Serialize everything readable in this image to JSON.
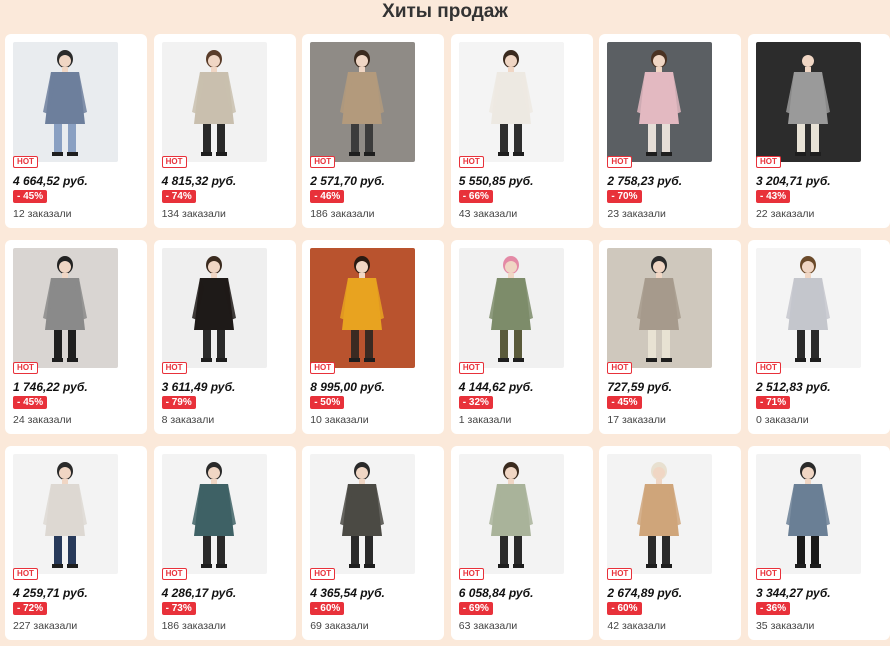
{
  "section_title": "Хиты продаж",
  "colors": {
    "background": "#fbe9da",
    "accent_red": "#e8313a"
  },
  "products": [
    {
      "badge": "HOT",
      "price": "4 664,52 руб.",
      "discount": "- 45%",
      "orders": "12 заказали",
      "image": "woman-blue-jacket-photo"
    },
    {
      "badge": "HOT",
      "price": "4 815,32 руб.",
      "discount": "- 74%",
      "orders": "134 заказали",
      "image": "woman-beige-puffer-coat-photo"
    },
    {
      "badge": "HOT",
      "price": "2 571,70 руб.",
      "discount": "- 46%",
      "orders": "186 заказали",
      "image": "woman-trench-coat-photo"
    },
    {
      "badge": "HOT",
      "price": "5 550,85 руб.",
      "discount": "- 66%",
      "orders": "43 заказали",
      "image": "woman-white-fur-coat-photo"
    },
    {
      "badge": "HOT",
      "price": "2 758,23 руб.",
      "discount": "- 70%",
      "orders": "23 заказали",
      "image": "woman-pink-jacket-photo"
    },
    {
      "badge": "HOT",
      "price": "3 204,71 руб.",
      "discount": "- 43%",
      "orders": "22 заказали",
      "image": "patterned-jacket-photo"
    },
    {
      "badge": "HOT",
      "price": "1 746,22 руб.",
      "discount": "- 45%",
      "orders": "24 заказали",
      "image": "woman-hat-grey-coat-photo"
    },
    {
      "badge": "HOT",
      "price": "3 611,49 руб.",
      "discount": "- 79%",
      "orders": "8 заказали",
      "image": "woman-black-leather-jacket-photo"
    },
    {
      "badge": "HOT",
      "price": "8 995,00 руб.",
      "discount": "- 50%",
      "orders": "10 заказали",
      "image": "woman-yellow-puffer-photo"
    },
    {
      "badge": "HOT",
      "price": "4 144,62 руб.",
      "discount": "- 32%",
      "orders": "1 заказали",
      "image": "woman-snakeskin-jacket-photo"
    },
    {
      "badge": "HOT",
      "price": "727,59 руб.",
      "discount": "- 45%",
      "orders": "17 заказали",
      "image": "woman-plaid-cardigan-photo"
    },
    {
      "badge": "HOT",
      "price": "2 512,83 руб.",
      "discount": "- 71%",
      "orders": "0 заказали",
      "image": "woman-silver-puffer-photo"
    },
    {
      "badge": "HOT",
      "price": "4 259,71 руб.",
      "discount": "- 72%",
      "orders": "227 заказали",
      "image": "woman-white-long-puffer-photo"
    },
    {
      "badge": "HOT",
      "price": "4 286,17 руб.",
      "discount": "- 73%",
      "orders": "186 заказали",
      "image": "woman-teal-long-coat-photo"
    },
    {
      "badge": "HOT",
      "price": "4 365,54 руб.",
      "discount": "- 60%",
      "orders": "69 заказали",
      "image": "woman-dark-trench-photo"
    },
    {
      "badge": "HOT",
      "price": "6 058,84 руб.",
      "discount": "- 69%",
      "orders": "63 заказали",
      "image": "woman-sage-fleece-coat-photo"
    },
    {
      "badge": "HOT",
      "price": "2 674,89 руб.",
      "discount": "- 60%",
      "orders": "42 заказали",
      "image": "woman-beige-trench-hat-photo"
    },
    {
      "badge": "HOT",
      "price": "3 344,27 руб.",
      "discount": "- 36%",
      "orders": "35 заказали",
      "image": "woman-denim-jacket-photo"
    }
  ]
}
